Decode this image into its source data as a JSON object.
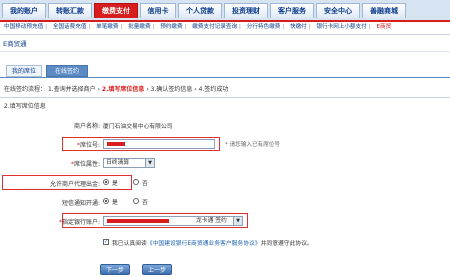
{
  "tabs": [
    "我的账户",
    "转账汇款",
    "缴费支付",
    "信用卡",
    "个人贷款",
    "投资理财",
    "客户服务",
    "安全中心",
    "善融商城"
  ],
  "active_tab_index": 2,
  "subnav": [
    "中国移动预充值",
    "全国话费充值",
    "单笔缴费",
    "批量缴费",
    "预约缴费",
    "缴费支付记录查询",
    "分行特色缴费",
    "快缴付",
    "银行卡网上小额支付",
    "E商贸"
  ],
  "section_title": "E商贸通",
  "subtabs": [
    "我的席位",
    "在线签约"
  ],
  "active_subtab_index": 1,
  "flow": {
    "prefix": "在线签约流程：",
    "step1": "1.查询并选择商户",
    "step2": "2.填写席位信息",
    "step3": "3.确认签约信息",
    "step4": "4.签约成功"
  },
  "step_heading": "2.填写席位信息",
  "form": {
    "merchant_label": "商户名称:",
    "merchant_value": "厦门石油交易中心有限公司",
    "seat_no_label": "席位号:",
    "seat_no_hint": "请您输入已有席位号",
    "seat_attr_label": "席位属性:",
    "seat_attr_value": "日终清算",
    "proxy_label": "允许商户代理出金:",
    "yes": "是",
    "no": "否",
    "sms_label": "短信通知开通:",
    "bank_account_label": "指定银行账户:",
    "bank_account_suffix": "龙卡通 签约",
    "agree_prefix": "我已认真阅读",
    "agree_link": "《中国建设银行E商贸通业务客户服务协议》",
    "agree_suffix": "并同意遵守此协议。"
  },
  "buttons": {
    "next": "下一步",
    "prev": "上一步"
  },
  "colors": {
    "accent": "#d71d1d",
    "nav_blue": "#0b3c8c",
    "button_blue": "#3f6fae"
  }
}
